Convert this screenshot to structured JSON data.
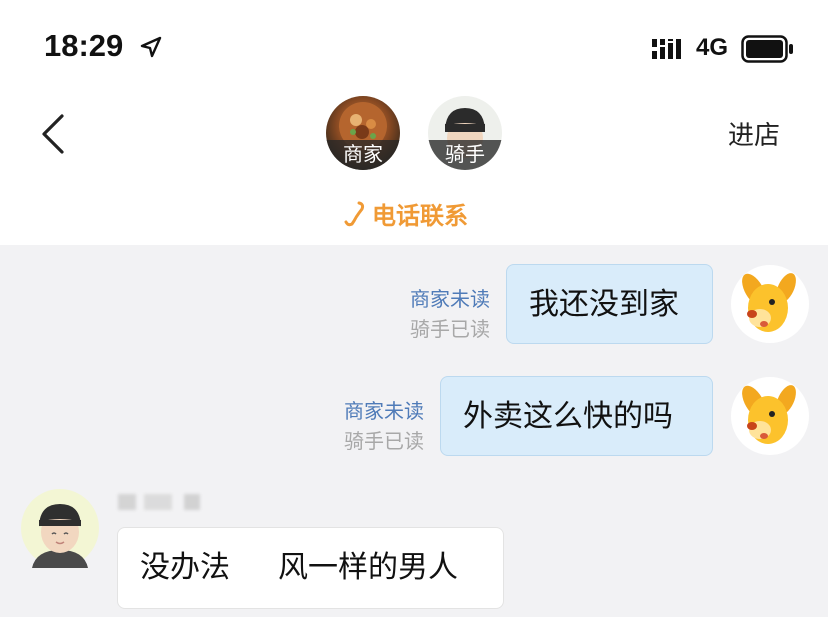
{
  "status_bar": {
    "time": "18:29",
    "network": "4G",
    "icons": [
      "location-arrow-icon",
      "signal-bars-icon",
      "battery-icon"
    ]
  },
  "header": {
    "back_icon": "chevron-left-icon",
    "merchant_label": "商家",
    "rider_label": "骑手",
    "enter_store": "进店",
    "phone_contact": "电话联系",
    "phone_icon": "phone-icon",
    "accent_color": "#f09a35"
  },
  "messages": [
    {
      "direction": "out",
      "text": "我还没到家",
      "merchant_status": "商家未读",
      "rider_status": "骑手已读"
    },
    {
      "direction": "out",
      "text": "外卖这么快的吗",
      "merchant_status": "商家未读",
      "rider_status": "骑手已读"
    },
    {
      "direction": "in",
      "text_part1": "没办法",
      "text_part2": "风一样的男人"
    }
  ],
  "colors": {
    "chat_background": "#f2f2f4",
    "outgoing_bubble": "#d9ecfa",
    "incoming_bubble": "#ffffff",
    "unread_status": "#4f7bb8",
    "read_status": "#a8a8a8"
  }
}
